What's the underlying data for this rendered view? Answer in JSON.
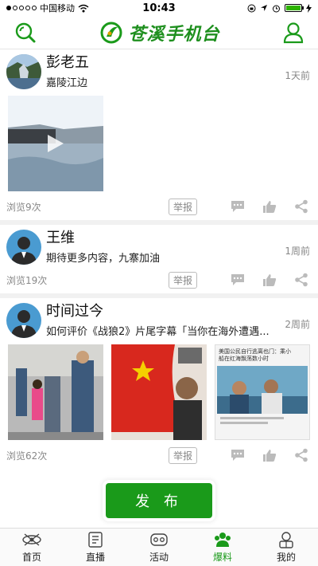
{
  "status": {
    "carrier": "中国移动",
    "time": "10:43"
  },
  "header": {
    "title": "苍溪手机台"
  },
  "posts": [
    {
      "name": "彭老五",
      "text": "嘉陵江边",
      "time": "1天前",
      "views": "浏览9次",
      "report": "举报"
    },
    {
      "name": "王维",
      "text": "期待更多内容，九寨加油",
      "time": "1周前",
      "views": "浏览19次",
      "report": "举报"
    },
    {
      "name": "时间过今",
      "text": "如何评价《战狼2》片尾字幕「当你在海外遭遇...",
      "time": "2周前",
      "views": "浏览62次",
      "report": "举报",
      "thumb3": {
        "line1": "美国公民自行逃离也门：乘小",
        "line2": "船在红海飘荡数小时"
      }
    }
  ],
  "publish_label": "发 布",
  "tabs": [
    {
      "label": "首页",
      "icon": "home-icon"
    },
    {
      "label": "直播",
      "icon": "live-icon"
    },
    {
      "label": "活动",
      "icon": "activity-icon"
    },
    {
      "label": "爆料",
      "icon": "tips-icon",
      "active": true
    },
    {
      "label": "我的",
      "icon": "profile-icon"
    }
  ],
  "colors": {
    "accent": "#1a9a1a",
    "muted": "#888888"
  }
}
